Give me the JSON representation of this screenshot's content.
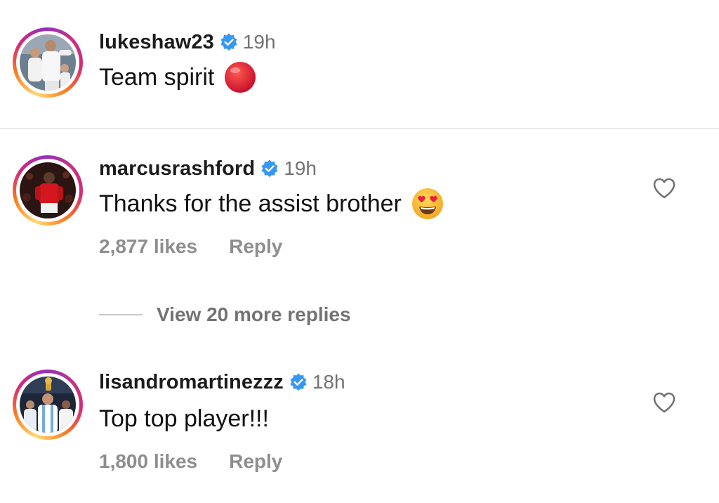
{
  "caption": {
    "username": "lukeshaw23",
    "time": "19h",
    "text": "Team spirit",
    "emoji": "red-circle"
  },
  "comments": [
    {
      "username": "marcusrashford",
      "time": "19h",
      "text": "Thanks for the assist brother",
      "emoji": "smiling-face-with-heart-eyes",
      "likes": "2,877 likes",
      "reply_label": "Reply"
    },
    {
      "username": "lisandromartinezzz",
      "time": "18h",
      "text": "Top top player!!!",
      "likes": "1,800 likes",
      "reply_label": "Reply"
    }
  ],
  "view_more_replies": "View 20 more replies",
  "colors": {
    "verified_badge": "#3897f0",
    "secondary_text": "#737373",
    "meta_text": "#8e8e8e",
    "divider": "#dbdbdb"
  },
  "icons": {
    "verified": "verified-badge-icon",
    "like": "heart-outline-icon"
  }
}
